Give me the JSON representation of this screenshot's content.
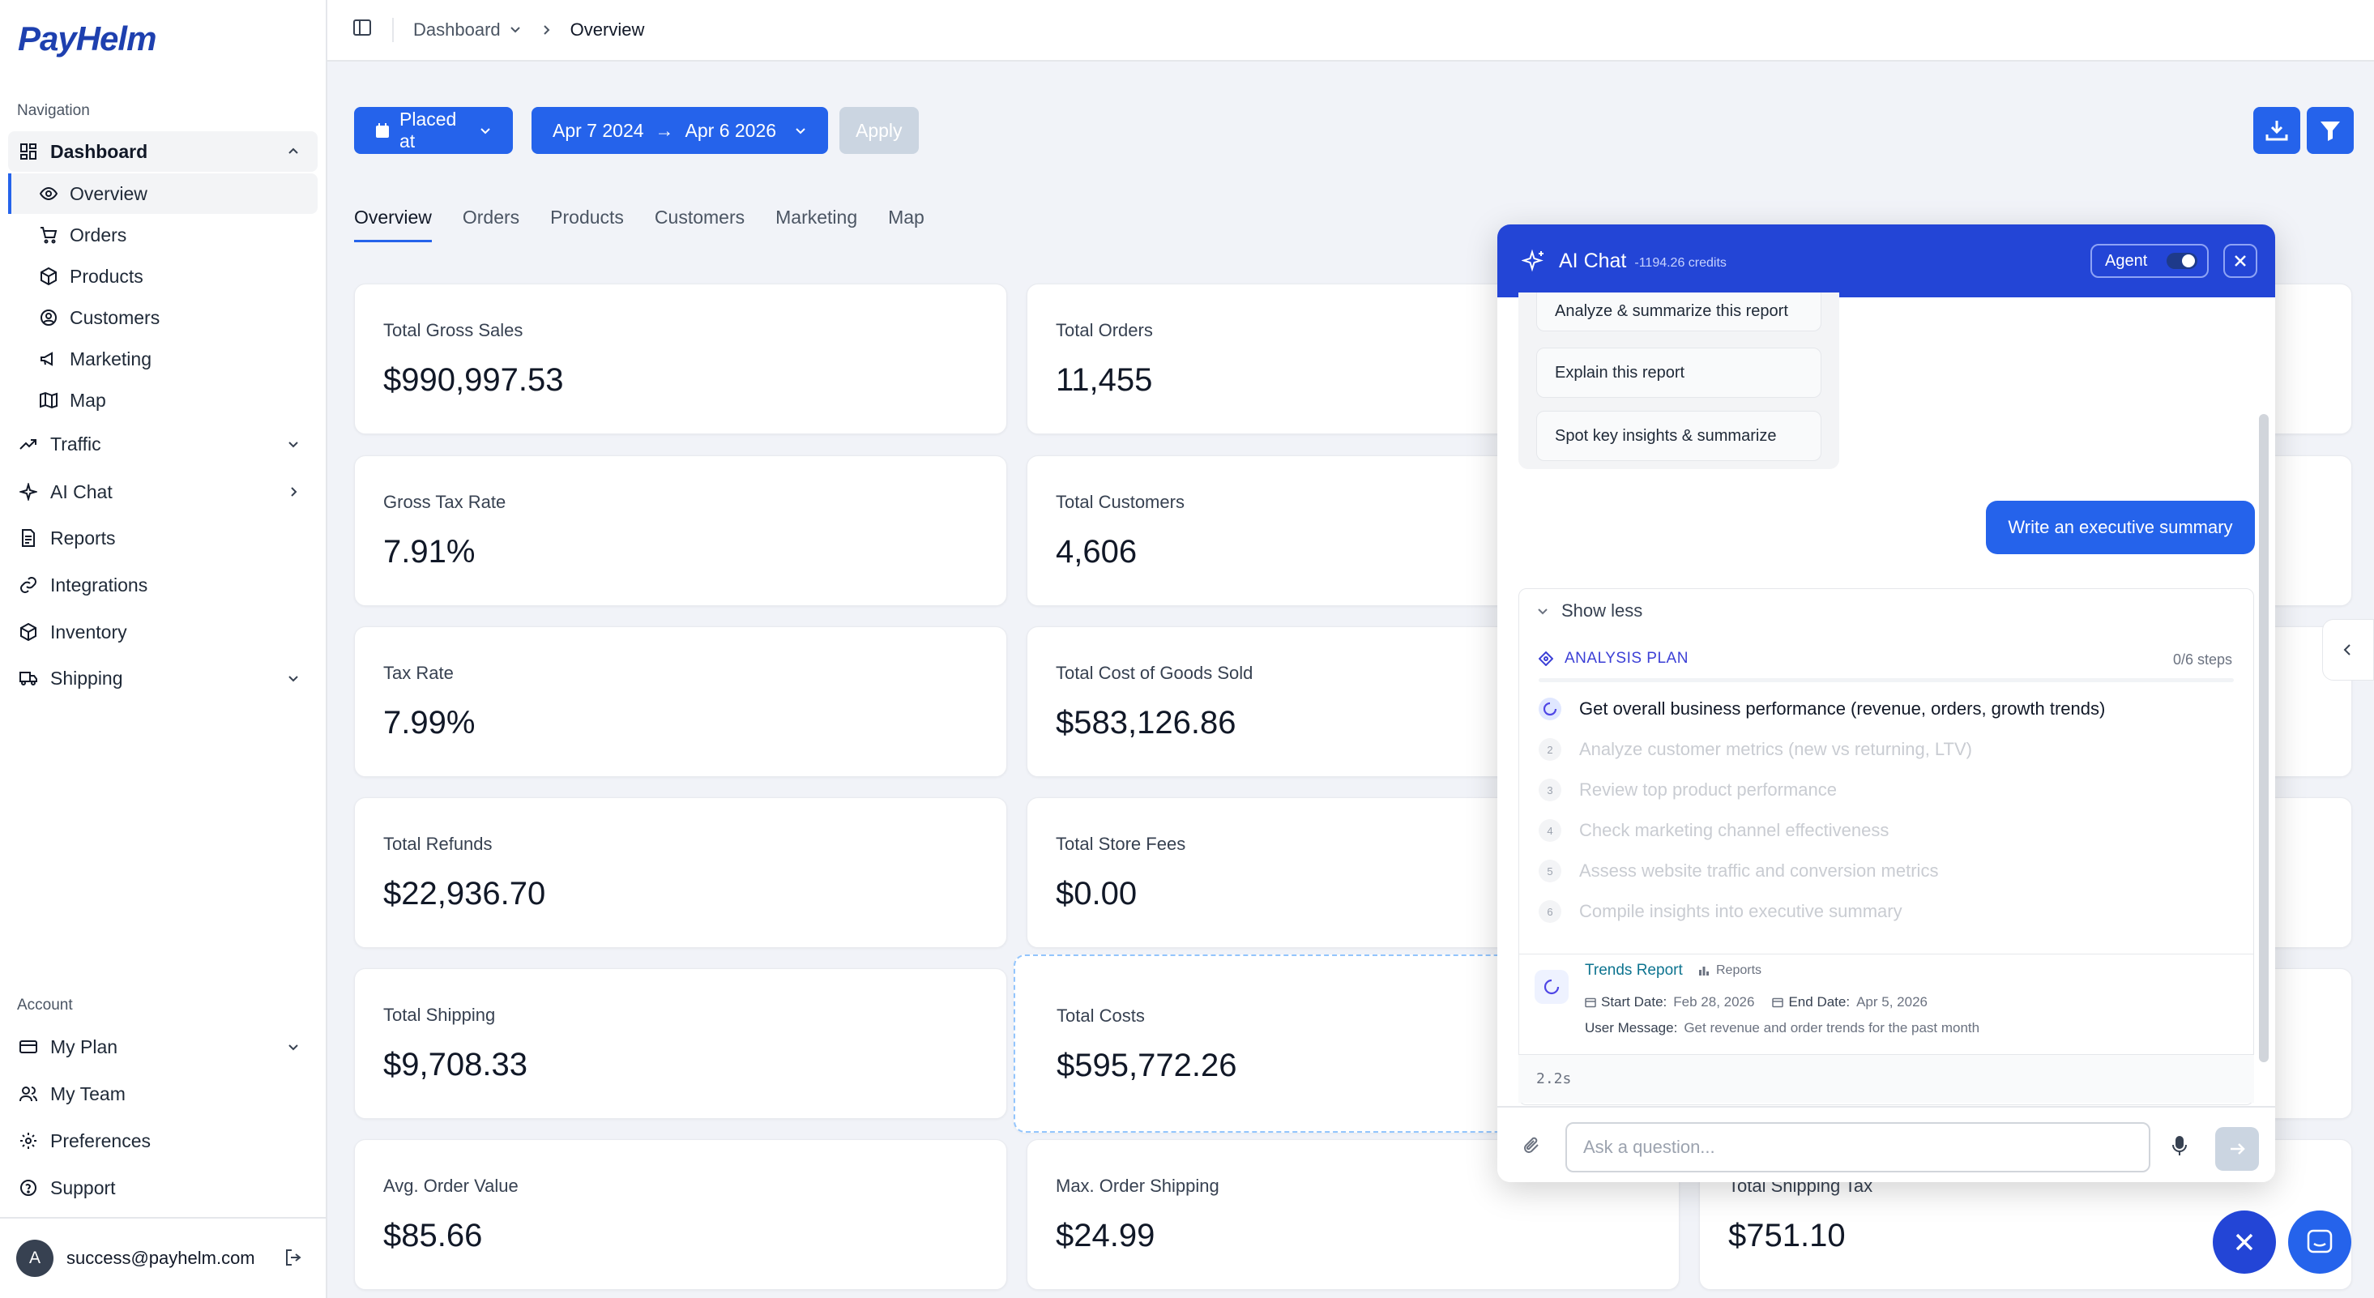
{
  "app": {
    "logo": "PayHelm"
  },
  "sidebar": {
    "nav_label": "Navigation",
    "dashboard": "Dashboard",
    "sub": [
      {
        "label": "Overview",
        "icon": "eye-icon"
      },
      {
        "label": "Orders",
        "icon": "cart-icon"
      },
      {
        "label": "Products",
        "icon": "box-icon"
      },
      {
        "label": "Customers",
        "icon": "user-circle-icon"
      },
      {
        "label": "Marketing",
        "icon": "megaphone-icon"
      },
      {
        "label": "Map",
        "icon": "map-icon"
      }
    ],
    "items": [
      {
        "label": "Traffic",
        "icon": "trend-icon"
      },
      {
        "label": "AI Chat",
        "icon": "sparkle-icon"
      },
      {
        "label": "Reports",
        "icon": "report-icon"
      },
      {
        "label": "Integrations",
        "icon": "link-icon"
      },
      {
        "label": "Inventory",
        "icon": "cube-icon"
      },
      {
        "label": "Shipping",
        "icon": "truck-icon"
      }
    ],
    "account_label": "Account",
    "account": [
      {
        "label": "My Plan",
        "icon": "card-icon"
      },
      {
        "label": "My Team",
        "icon": "team-icon"
      },
      {
        "label": "Preferences",
        "icon": "gear-icon"
      },
      {
        "label": "Support",
        "icon": "help-icon"
      }
    ],
    "user": {
      "initial": "A",
      "email": "success@payhelm.com"
    }
  },
  "topbar": {
    "crumb": "Dashboard",
    "current": "Overview"
  },
  "filters": {
    "placed_at": "Placed at",
    "date_from": "Apr 7 2024",
    "arrow": "→",
    "date_to": "Apr 6 2026",
    "apply": "Apply"
  },
  "tabs": [
    "Overview",
    "Orders",
    "Products",
    "Customers",
    "Marketing",
    "Map"
  ],
  "cards": [
    {
      "label": "Total Gross Sales",
      "value": "$990,997.53"
    },
    {
      "label": "Total Orders",
      "value": "11,455"
    },
    {
      "label": "Gross Tax Rate",
      "value": "7.91%"
    },
    {
      "label": "Total Customers",
      "value": "4,606"
    },
    {
      "label": "Tax Rate",
      "value": "7.99%"
    },
    {
      "label": "Total Cost of Goods Sold",
      "value": "$583,126.86"
    },
    {
      "label": "Total Refunds",
      "value": "$22,936.70"
    },
    {
      "label": "Total Store Fees",
      "value": "$0.00"
    },
    {
      "label": "Total Shipping",
      "value": "$9,708.33"
    },
    {
      "label": "Total Costs",
      "value": "$595,772.26"
    },
    {
      "label": "Avg. Order Value",
      "value": "$85.66"
    },
    {
      "label": "Max. Order Shipping",
      "value": "$24.99"
    },
    {
      "label": "Total Shipping Tax",
      "value": "$751.10"
    }
  ],
  "chat": {
    "title": "AI Chat",
    "credits": "-1194.26 credits",
    "agent_label": "Agent",
    "suggestions": [
      "Analyze & summarize this report",
      "Explain this report",
      "Spot key insights & summarize"
    ],
    "user_message": "Write an executive summary",
    "show_less": "Show less",
    "plan_title": "ANALYSIS PLAN",
    "plan_progress": "0/6 steps",
    "steps": [
      {
        "n": "",
        "text": "Get overall business performance (revenue, orders, growth trends)"
      },
      {
        "n": "2",
        "text": "Analyze customer metrics (new vs returning, LTV)"
      },
      {
        "n": "3",
        "text": "Review top product performance"
      },
      {
        "n": "4",
        "text": "Check marketing channel effectiveness"
      },
      {
        "n": "5",
        "text": "Assess website traffic and conversion metrics"
      },
      {
        "n": "6",
        "text": "Compile insights into executive summary"
      }
    ],
    "tool": {
      "title": "Trends Report",
      "tag": "Reports",
      "start_label": "Start Date:",
      "start": "Feb 28, 2026",
      "end_label": "End Date:",
      "end": "Apr 5, 2026",
      "msg_label": "User Message:",
      "msg": "Get revenue and order trends for the past month"
    },
    "timer": "2.2s",
    "input_placeholder": "Ask a question..."
  }
}
